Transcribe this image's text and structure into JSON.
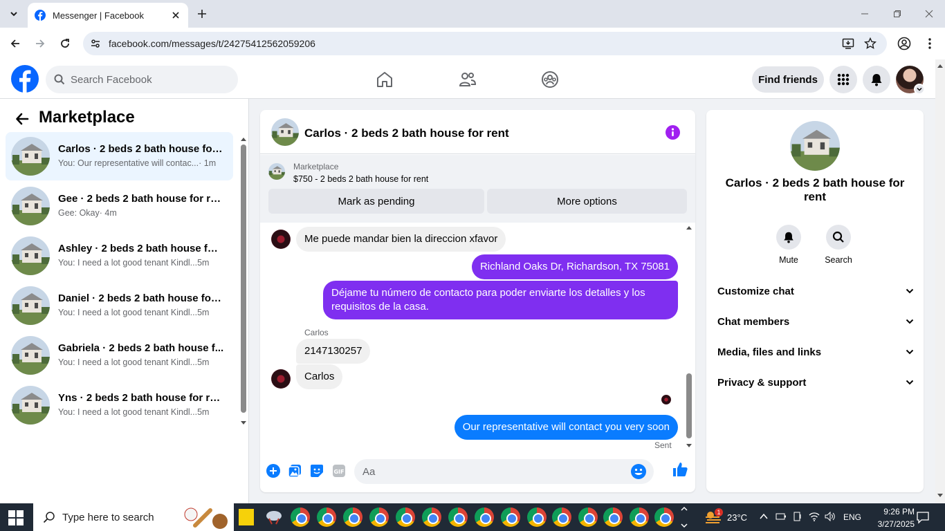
{
  "browser": {
    "tab_title": "Messenger | Facebook",
    "url": "facebook.com/messages/t/24275412562059206"
  },
  "header": {
    "search_placeholder": "Search Facebook",
    "find_friends_label": "Find friends"
  },
  "sidebar": {
    "title": "Marketplace",
    "conversations": [
      {
        "name": "Carlos · 2 beds 2 bath house for ...",
        "preview": "You: Our representative will contac...",
        "time": "· 1m",
        "active": true
      },
      {
        "name": "Gee · 2 beds 2 bath house for rent",
        "preview": "Gee: Okay",
        "time": "· 4m",
        "active": false
      },
      {
        "name": "Ashley · 2 beds 2 bath house for...",
        "preview": "You: I need a lot good tenant Kindl...",
        "time": "5m",
        "active": false
      },
      {
        "name": "Daniel · 2 beds 2 bath house for ...",
        "preview": "You: I need a lot good tenant Kindl...",
        "time": "5m",
        "active": false
      },
      {
        "name": "Gabriela · 2 beds 2 bath house f...",
        "preview": "You: I need a lot good tenant Kindl...",
        "time": "5m",
        "active": false
      },
      {
        "name": "Yns · 2 beds 2 bath house for rent",
        "preview": "You: I need a lot good tenant Kindl...",
        "time": "5m",
        "active": false
      }
    ]
  },
  "chat": {
    "title": "Carlos · 2 beds 2 bath house for rent",
    "listing_source": "Marketplace",
    "listing_title": "$750 - 2 beds 2 bath house for rent",
    "mark_pending_label": "Mark as pending",
    "more_options_label": "More options",
    "messages": [
      {
        "from": "them",
        "text": "Me puede mandar bien la direccion xfavor"
      },
      {
        "from": "me",
        "text": "Richland Oaks Dr, Richardson, TX 75081"
      },
      {
        "from": "me",
        "text": "Déjame tu número de contacto para poder enviarte los detalles y los requisitos de la casa."
      },
      {
        "from": "them",
        "sender": "Carlos",
        "text": "2147130257"
      },
      {
        "from": "them",
        "text": "Carlos"
      },
      {
        "from": "me",
        "text": "Our representative will contact you very soon"
      }
    ],
    "sent_status": "Sent",
    "composer_placeholder": "Aa"
  },
  "details": {
    "title": "Carlos · 2 beds 2 bath house for rent",
    "mute_label": "Mute",
    "search_label": "Search",
    "sections": [
      "Customize chat",
      "Chat members",
      "Media, files and links",
      "Privacy & support"
    ]
  },
  "taskbar": {
    "search_placeholder": "Type here to search",
    "weather_badge": "1",
    "temperature": "23°C",
    "language": "ENG",
    "time": "9:26 PM",
    "date": "3/27/2025"
  },
  "colors": {
    "fb_blue": "#0866ff",
    "outgoing_bubble": "#7f2ff0",
    "last_bubble": "#0a7cff",
    "accent_icon": "#a020f0"
  }
}
